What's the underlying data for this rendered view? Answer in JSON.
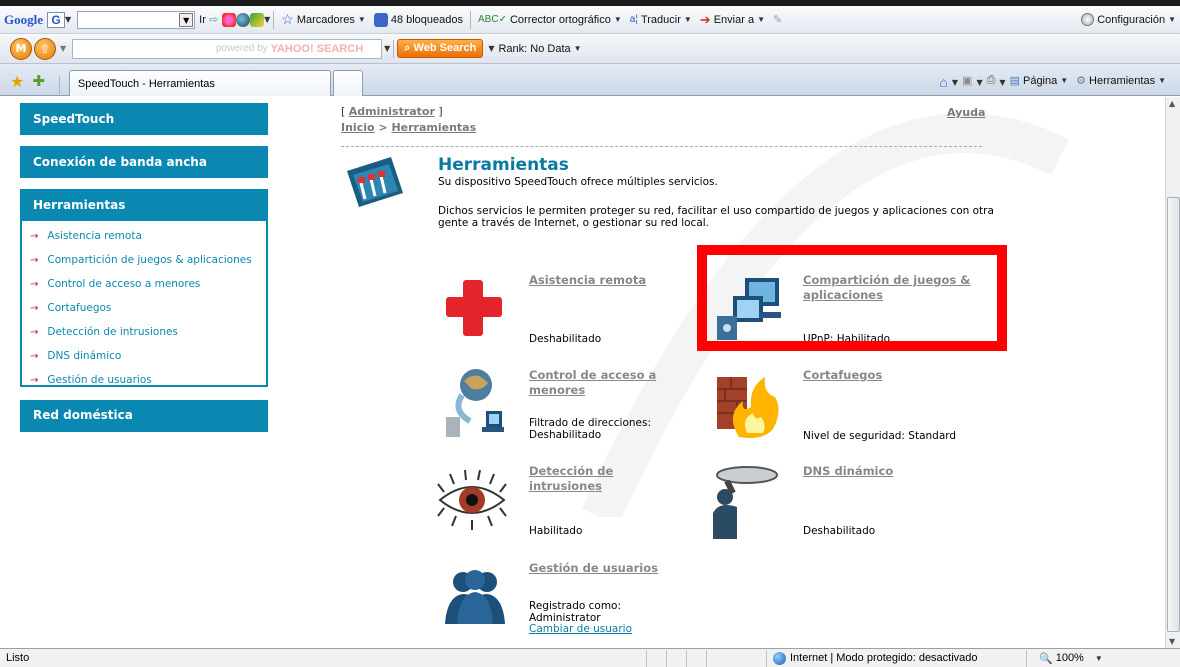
{
  "toolbar1": {
    "google_label": "Google",
    "go_label": "Ir",
    "bookmarks_label": "Marcadores",
    "blocked_label": "48 bloqueados",
    "spellcheck_label": "Corrector ortográfico",
    "translate_label": "Traducir",
    "send_label": "Enviar a",
    "settings_label": "Configuración"
  },
  "toolbar2": {
    "search_placeholder": "powered by",
    "yahoo_label": "YAHOO! SEARCH",
    "web_search_label": "Web Search",
    "rank_label": "Rank: No Data"
  },
  "tabbar": {
    "tab_title": "SpeedTouch - Herramientas",
    "page_label": "Página",
    "tools_label": "Herramientas"
  },
  "sidebar": {
    "speedtouch": "SpeedTouch",
    "broadband": "Conexión de banda ancha",
    "tools_header": "Herramientas",
    "items": [
      "Asistencia remota",
      "Compartición de juegos & aplicaciones",
      "Control de acceso a menores",
      "Cortafuegos",
      "Detección de intrusiones",
      "DNS dinámico",
      "Gestión de usuarios"
    ],
    "home_network": "Red doméstica"
  },
  "header": {
    "user_link": "Administrator",
    "help_link": "Ayuda",
    "breadcrumb_home": "Inicio",
    "breadcrumb_sep": " > ",
    "breadcrumb_current": "Herramientas"
  },
  "intro": {
    "title": "Herramientas",
    "subtitle": "Su dispositivo SpeedTouch ofrece múltiples servicios.",
    "description": "Dichos servicios le permiten proteger su red, facilitar el uso compartido de juegos y aplicaciones con otra gente a través de Internet, o gestionar su red local."
  },
  "services": {
    "remote": {
      "title": "Asistencia remota",
      "status": "Deshabilitado"
    },
    "gaming": {
      "title": "Compartición de juegos & aplicaciones",
      "status": "UPnP: Habilitado"
    },
    "parental": {
      "title": "Control de acceso a menores",
      "status": "Filtrado de direcciones: Deshabilitado"
    },
    "firewall": {
      "title": "Cortafuegos",
      "status": "Nivel de seguridad: Standard"
    },
    "intrusion": {
      "title": "Detección de intrusiones",
      "status": "Habilitado"
    },
    "dyndns": {
      "title": "DNS dinámico",
      "status": "Deshabilitado"
    },
    "users": {
      "title": "Gestión de usuarios",
      "status": "Registrado como: Administrator",
      "change_link": "Cambiar de usuario"
    }
  },
  "statusbar": {
    "ready": "Listo",
    "zone": "Internet | Modo protegido: desactivado",
    "zoom": "100%"
  }
}
